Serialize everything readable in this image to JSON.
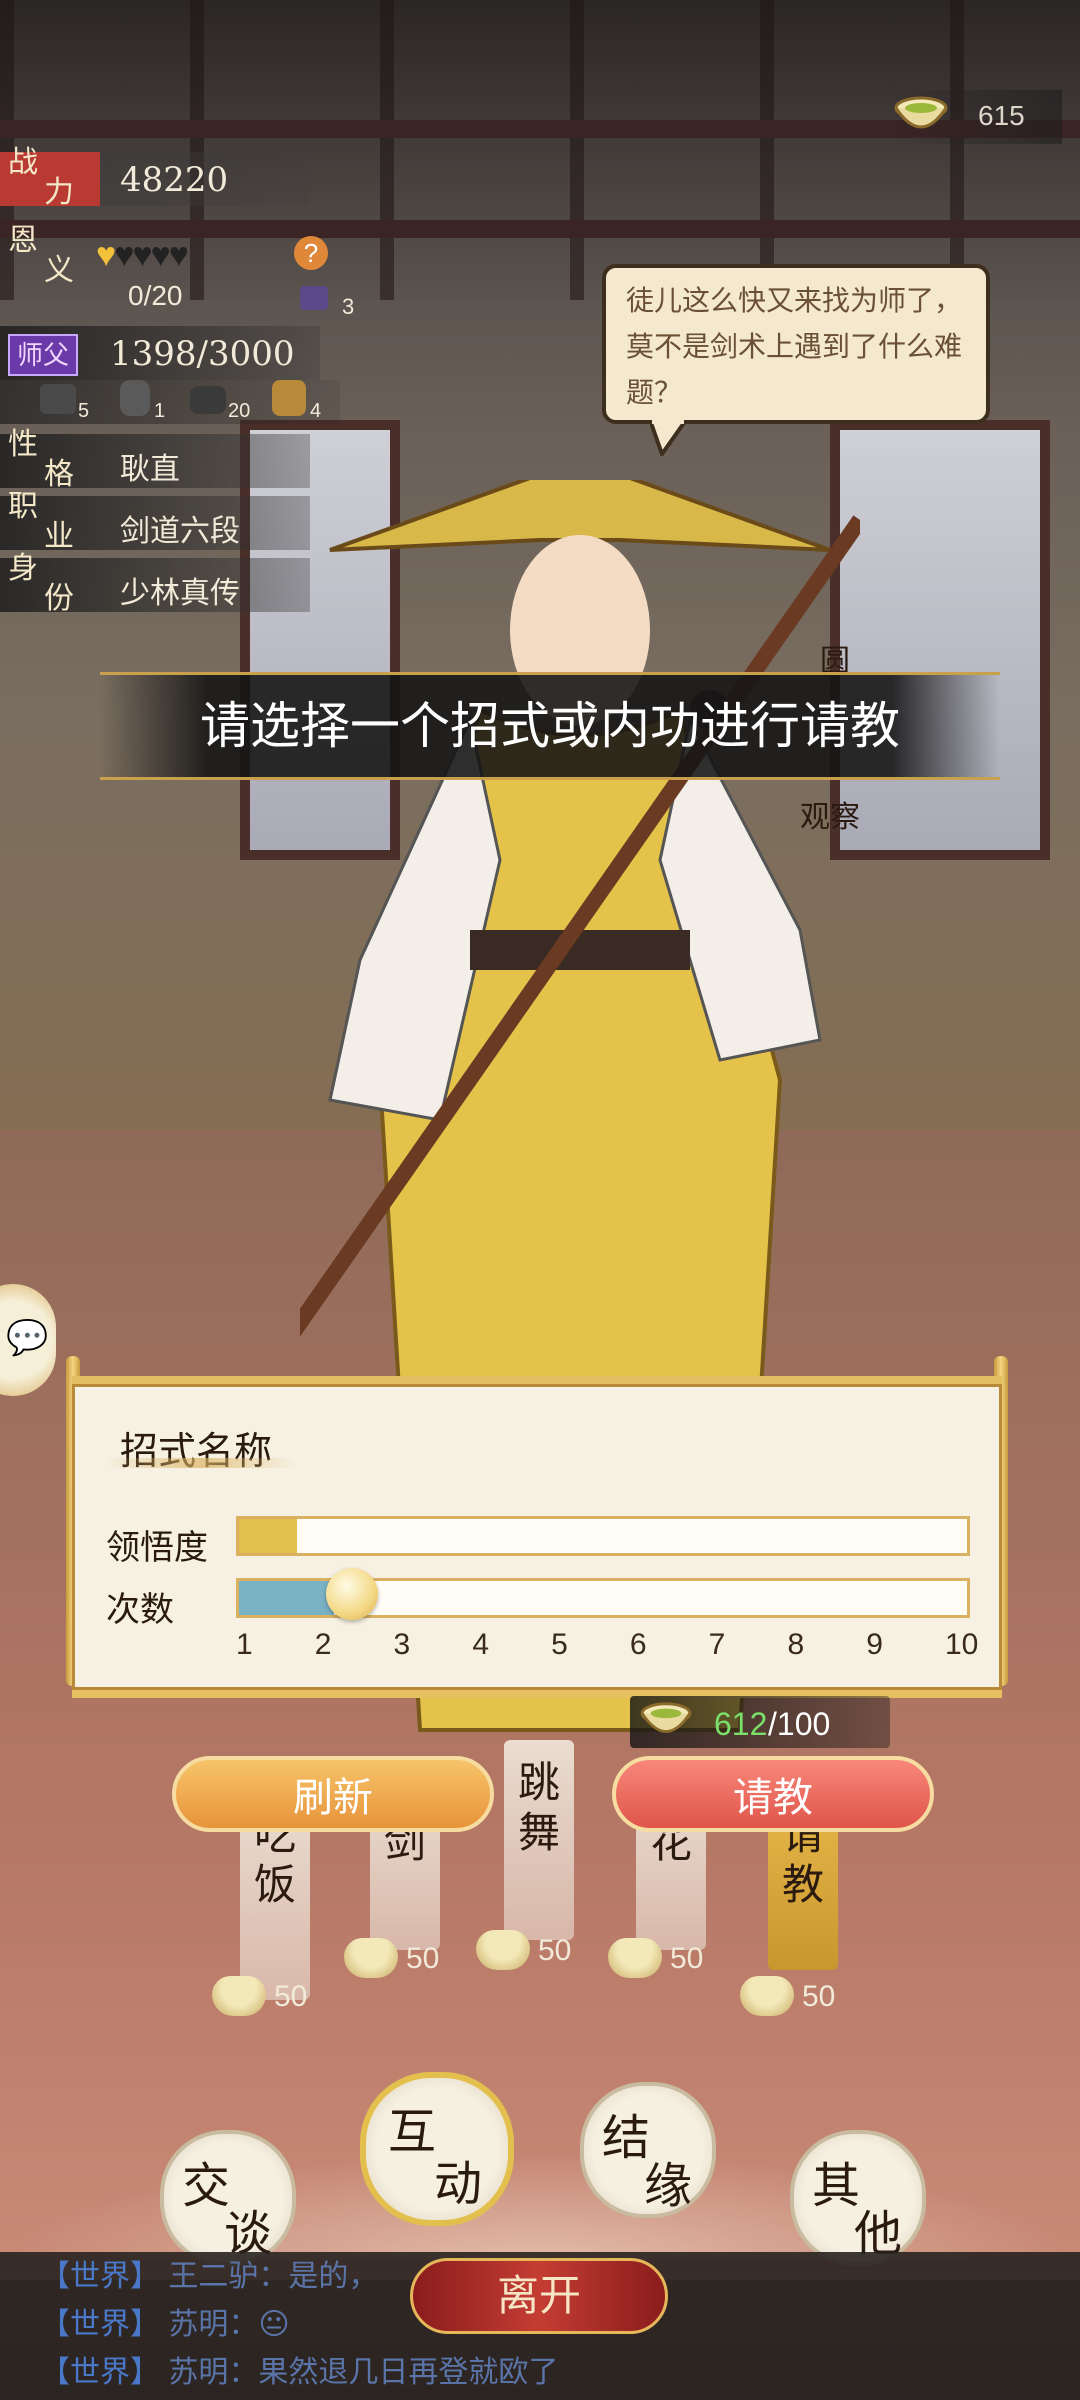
{
  "currency": {
    "amount": "615"
  },
  "stats": {
    "power_key": [
      "战",
      "力"
    ],
    "power_value": "48220",
    "favor_key": [
      "恩",
      "义"
    ],
    "favor_count": "0/20",
    "favor_item_count": "3",
    "favor_hearts_filled": 1,
    "favor_hearts_total": 5,
    "master_badge": "师父",
    "master_value": "1398/3000",
    "items": [
      "5",
      "1",
      "20",
      "4"
    ],
    "personality_key": [
      "性",
      "格"
    ],
    "personality_value": "耿直",
    "job_key": [
      "职",
      "业"
    ],
    "job_value": "剑道六段",
    "identity_key": [
      "身",
      "份"
    ],
    "identity_value": "少林真传"
  },
  "dialog": {
    "text": "徒儿这么快又来找为师了，莫不是剑术上遇到了什么难题？"
  },
  "side_labels": {
    "round": "圆",
    "observe": "观察"
  },
  "banner": {
    "text": "请选择一个招式或内功进行请教"
  },
  "skill_panel": {
    "title": "招式名称",
    "comprehension_label": "领悟度",
    "comprehension_fraction": 0.08,
    "times_label": "次数",
    "times_value": 2,
    "ticks": [
      "1",
      "2",
      "3",
      "4",
      "5",
      "6",
      "7",
      "8",
      "9",
      "10"
    ]
  },
  "cost": {
    "have": "612",
    "need": "/100"
  },
  "buttons": {
    "refresh": "刷新",
    "consult": "请教",
    "leave": "离开"
  },
  "action_cards": [
    {
      "label": "吃饭",
      "cost": "50"
    },
    {
      "label": "剑",
      "cost": "50"
    },
    {
      "label": "跳舞",
      "cost": "50"
    },
    {
      "label": "花",
      "cost": "50"
    },
    {
      "label": "请教",
      "cost": "50"
    }
  ],
  "menu": {
    "chat": [
      "交",
      "谈"
    ],
    "interact": [
      "互",
      "动"
    ],
    "bond": [
      "结",
      "缘"
    ],
    "other": [
      "其",
      "他"
    ]
  },
  "chat_log": [
    {
      "channel": "【世界】",
      "text": "王二驴：是的，"
    },
    {
      "channel": "【世界】",
      "text": "苏明：😐"
    },
    {
      "channel": "【世界】",
      "text": "苏明：果然退几日再登就欧了"
    }
  ],
  "colors": {
    "accent_gold": "#e6bf63",
    "refresh_orange": "#f2a64a",
    "consult_red": "#ec6a5c",
    "currency_green": "#7be06a"
  }
}
